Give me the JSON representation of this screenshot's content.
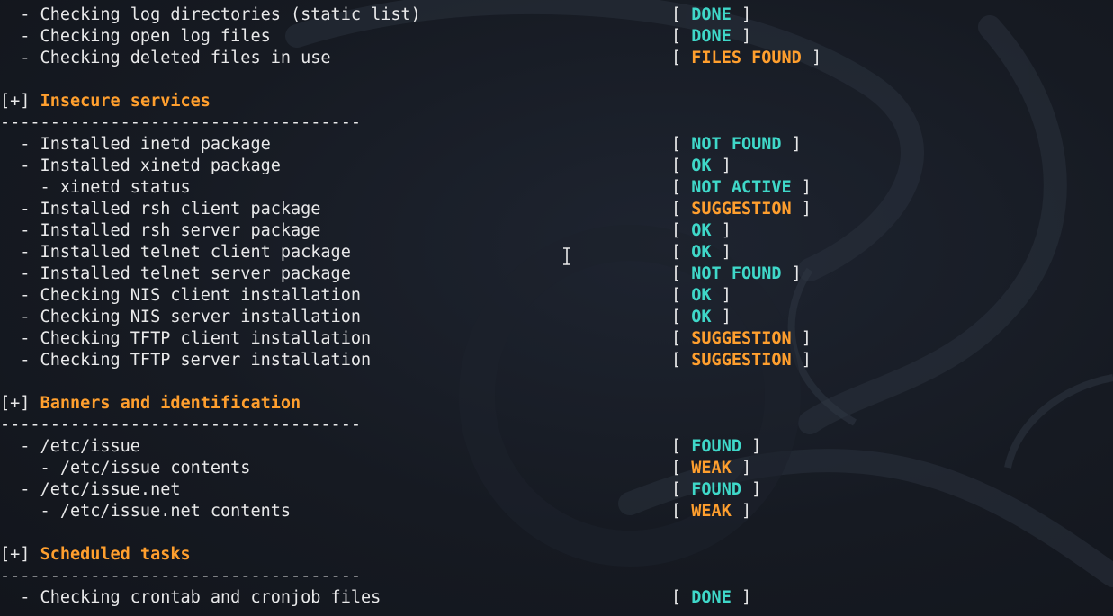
{
  "colors": {
    "ok": "#3fd8c9",
    "warn": "#ff9f2e",
    "text": "#e9e9ea",
    "background": "#161a22"
  },
  "lines": [
    {
      "kind": "item",
      "label": "  - Checking log directories (static list)",
      "status": "DONE",
      "tone": "ok"
    },
    {
      "kind": "item",
      "label": "  - Checking open log files",
      "status": "DONE",
      "tone": "ok"
    },
    {
      "kind": "item",
      "label": "  - Checking deleted files in use",
      "status": "FILES FOUND",
      "tone": "warn"
    },
    {
      "kind": "blank"
    },
    {
      "kind": "section",
      "prefix": "[+] ",
      "title": "Insecure services"
    },
    {
      "kind": "separator",
      "text": "------------------------------------"
    },
    {
      "kind": "item",
      "label": "  - Installed inetd package",
      "status": "NOT FOUND",
      "tone": "ok"
    },
    {
      "kind": "item",
      "label": "  - Installed xinetd package",
      "status": "OK",
      "tone": "ok"
    },
    {
      "kind": "item",
      "label": "    - xinetd status",
      "status": "NOT ACTIVE",
      "tone": "ok"
    },
    {
      "kind": "item",
      "label": "  - Installed rsh client package",
      "status": "SUGGESTION",
      "tone": "warn"
    },
    {
      "kind": "item",
      "label": "  - Installed rsh server package",
      "status": "OK",
      "tone": "ok"
    },
    {
      "kind": "item",
      "label": "  - Installed telnet client package",
      "status": "OK",
      "tone": "ok"
    },
    {
      "kind": "item",
      "label": "  - Installed telnet server package",
      "status": "NOT FOUND",
      "tone": "ok"
    },
    {
      "kind": "item",
      "label": "  - Checking NIS client installation",
      "status": "OK",
      "tone": "ok"
    },
    {
      "kind": "item",
      "label": "  - Checking NIS server installation",
      "status": "OK",
      "tone": "ok"
    },
    {
      "kind": "item",
      "label": "  - Checking TFTP client installation",
      "status": "SUGGESTION",
      "tone": "warn"
    },
    {
      "kind": "item",
      "label": "  - Checking TFTP server installation",
      "status": "SUGGESTION",
      "tone": "warn"
    },
    {
      "kind": "blank"
    },
    {
      "kind": "section",
      "prefix": "[+] ",
      "title": "Banners and identification"
    },
    {
      "kind": "separator",
      "text": "------------------------------------"
    },
    {
      "kind": "item",
      "label": "  - /etc/issue",
      "status": "FOUND",
      "tone": "ok"
    },
    {
      "kind": "item",
      "label": "    - /etc/issue contents",
      "status": "WEAK",
      "tone": "warn"
    },
    {
      "kind": "item",
      "label": "  - /etc/issue.net",
      "status": "FOUND",
      "tone": "ok"
    },
    {
      "kind": "item",
      "label": "    - /etc/issue.net contents",
      "status": "WEAK",
      "tone": "warn"
    },
    {
      "kind": "blank"
    },
    {
      "kind": "section",
      "prefix": "[+] ",
      "title": "Scheduled tasks"
    },
    {
      "kind": "separator",
      "text": "------------------------------------"
    },
    {
      "kind": "item",
      "label": "  - Checking crontab and cronjob files",
      "status": "DONE",
      "tone": "ok"
    }
  ],
  "cursor_icon": "text-cursor-icon"
}
